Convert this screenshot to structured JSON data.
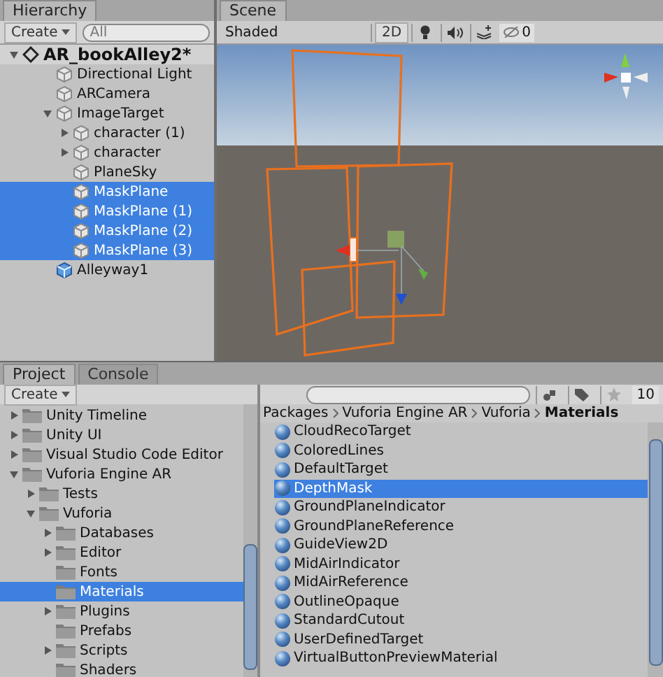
{
  "hierarchy": {
    "tab": "Hierarchy",
    "create_button": "Create",
    "search_placeholder": "All",
    "scene": {
      "name": "AR_bookAlley2*",
      "expanded": true,
      "children": [
        {
          "name": "Directional Light",
          "kind": "object",
          "selected": false
        },
        {
          "name": "ARCamera",
          "kind": "object",
          "selected": false
        },
        {
          "name": "ImageTarget",
          "kind": "object",
          "selected": false,
          "expanded": true,
          "children": [
            {
              "name": "character (1)",
              "kind": "object",
              "selected": false,
              "expanded": false
            },
            {
              "name": "character",
              "kind": "object",
              "selected": false,
              "expanded": false
            },
            {
              "name": "PlaneSky",
              "kind": "object",
              "selected": false
            },
            {
              "name": "MaskPlane",
              "kind": "object",
              "selected": true
            },
            {
              "name": "MaskPlane (1)",
              "kind": "object",
              "selected": true
            },
            {
              "name": "MaskPlane (2)",
              "kind": "object",
              "selected": true
            },
            {
              "name": "MaskPlane (3)",
              "kind": "object",
              "selected": true
            }
          ]
        },
        {
          "name": "Alleyway1",
          "kind": "prefab",
          "selected": false
        }
      ]
    }
  },
  "scene_view": {
    "tab": "Scene",
    "shading": "Shaded",
    "mode_2d": "2D",
    "hidden_count": "0"
  },
  "project": {
    "tabs": [
      {
        "label": "Project",
        "selected": true
      },
      {
        "label": "Console",
        "selected": false
      }
    ],
    "create_button": "Create",
    "hidden_count": "10",
    "folders": [
      {
        "name": "Unity Timeline",
        "selected": false,
        "expanded": false
      },
      {
        "name": "Unity UI",
        "selected": false,
        "expanded": false
      },
      {
        "name": "Visual Studio Code Editor",
        "selected": false,
        "expanded": false
      },
      {
        "name": "Vuforia Engine AR",
        "selected": false,
        "expanded": true,
        "children": [
          {
            "name": "Tests",
            "selected": false,
            "expanded": false
          },
          {
            "name": "Vuforia",
            "selected": false,
            "expanded": true,
            "children": [
              {
                "name": "Databases",
                "selected": false,
                "expanded": false
              },
              {
                "name": "Editor",
                "selected": false,
                "expanded": false
              },
              {
                "name": "Fonts",
                "selected": false
              },
              {
                "name": "Materials",
                "selected": true
              },
              {
                "name": "Plugins",
                "selected": false,
                "expanded": false
              },
              {
                "name": "Prefabs",
                "selected": false
              },
              {
                "name": "Scripts",
                "selected": false,
                "expanded": false
              },
              {
                "name": "Shaders",
                "selected": false
              }
            ]
          }
        ]
      }
    ],
    "breadcrumb": [
      "Packages",
      "Vuforia Engine AR",
      "Vuforia",
      "Materials"
    ],
    "assets": [
      {
        "name": "CloudRecoTarget",
        "selected": false
      },
      {
        "name": "ColoredLines",
        "selected": false
      },
      {
        "name": "DefaultTarget",
        "selected": false
      },
      {
        "name": "DepthMask",
        "selected": true
      },
      {
        "name": "GroundPlaneIndicator",
        "selected": false
      },
      {
        "name": "GroundPlaneReference",
        "selected": false
      },
      {
        "name": "GuideView2D",
        "selected": false
      },
      {
        "name": "MidAirIndicator",
        "selected": false
      },
      {
        "name": "MidAirReference",
        "selected": false
      },
      {
        "name": "OutlineOpaque",
        "selected": false
      },
      {
        "name": "StandardCutout",
        "selected": false
      },
      {
        "name": "UserDefinedTarget",
        "selected": false
      },
      {
        "name": "VirtualButtonPreviewMaterial",
        "selected": false
      }
    ]
  }
}
